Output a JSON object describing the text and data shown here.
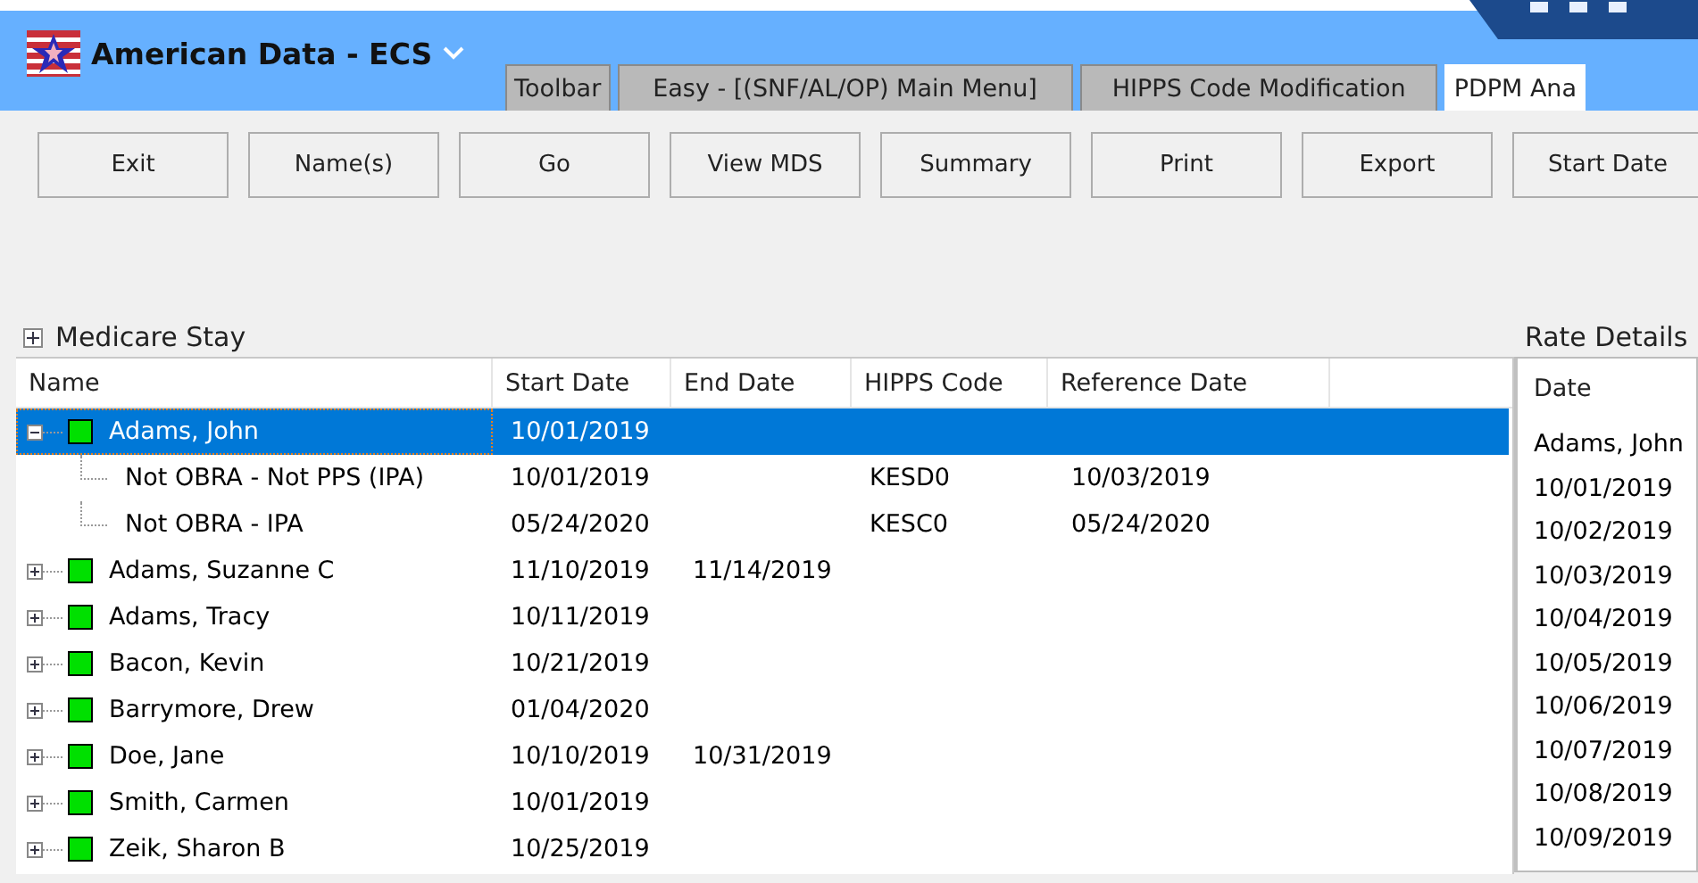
{
  "app": {
    "title": "American Data - ECS"
  },
  "tabs": [
    {
      "label": "Toolbar",
      "selected": false
    },
    {
      "label": "Easy - [(SNF/AL/OP) Main Menu]",
      "selected": false
    },
    {
      "label": "HIPPS Code Modification",
      "selected": false
    },
    {
      "label": "PDPM Ana",
      "selected": true
    }
  ],
  "toolbar": {
    "buttons": [
      "Exit",
      "Name(s)",
      "Go",
      "View MDS",
      "Summary",
      "Print",
      "Export",
      "Start Date"
    ]
  },
  "medicare_stay": {
    "title": "Medicare Stay",
    "expanded": false
  },
  "tree": {
    "columns": [
      "Name",
      "Start Date",
      "End Date",
      "HIPPS Code",
      "Reference Date"
    ],
    "rows": [
      {
        "name": "Adams, John",
        "start_date": "10/01/2019",
        "expanded": true,
        "selected": true,
        "children": [
          {
            "name": "Not OBRA - Not PPS (IPA)",
            "start_date": "10/01/2019",
            "hipps_code": "KESD0",
            "reference_date": "10/03/2019"
          },
          {
            "name": "Not OBRA - IPA",
            "start_date": "05/24/2020",
            "hipps_code": "KESC0",
            "reference_date": "05/24/2020"
          }
        ]
      },
      {
        "name": "Adams, Suzanne C",
        "start_date": "11/10/2019",
        "end_date": "11/14/2019",
        "expanded": false,
        "selected": false
      },
      {
        "name": "Adams, Tracy",
        "start_date": "10/11/2019",
        "expanded": false,
        "selected": false
      },
      {
        "name": "Bacon, Kevin",
        "start_date": "10/21/2019",
        "expanded": false,
        "selected": false
      },
      {
        "name": "Barrymore, Drew",
        "start_date": "01/04/2020",
        "expanded": false,
        "selected": false
      },
      {
        "name": "Doe, Jane",
        "start_date": "10/10/2019",
        "end_date": "10/31/2019",
        "expanded": false,
        "selected": false
      },
      {
        "name": "Smith, Carmen",
        "start_date": "10/01/2019",
        "expanded": false,
        "selected": false
      },
      {
        "name": "Zeik, Sharon B",
        "start_date": "10/25/2019",
        "expanded": false,
        "selected": false
      }
    ]
  },
  "rate_details": {
    "title": "Rate Details",
    "column": "Date",
    "rows": [
      "Adams, John",
      "10/01/2019",
      "10/02/2019",
      "10/03/2019",
      "10/04/2019",
      "10/05/2019",
      "10/06/2019",
      "10/07/2019",
      "10/08/2019",
      "10/09/2019"
    ]
  }
}
